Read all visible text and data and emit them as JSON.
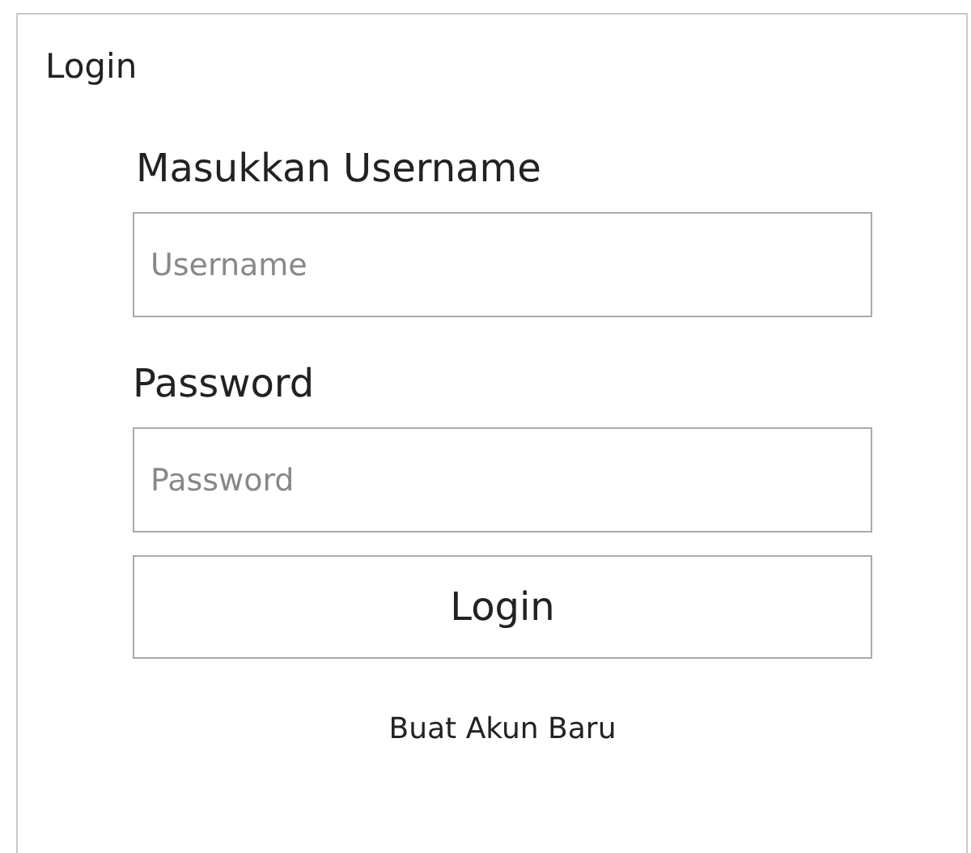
{
  "panel": {
    "title": "Login"
  },
  "fields": [
    {
      "label": "Masukkan Username",
      "placeholder": "Username"
    },
    {
      "label": "Password",
      "placeholder": "Password"
    }
  ],
  "submit": "Login",
  "register_link": "Buat Akun Baru"
}
